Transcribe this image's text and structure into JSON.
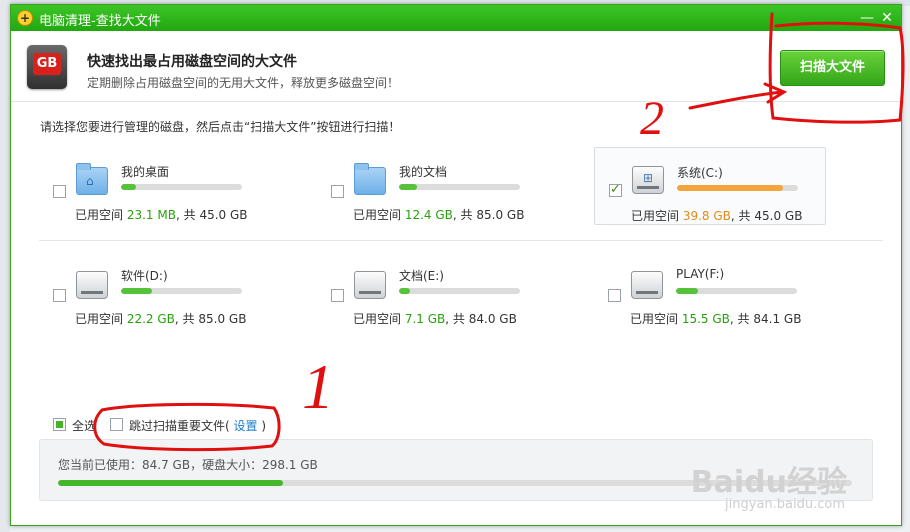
{
  "window": {
    "title": "电脑清理-查找大文件",
    "icon": "plus-icon",
    "controls": {
      "minimize": "—",
      "close": "✕"
    }
  },
  "header": {
    "icon_label": "GB",
    "title": "快速找出最占用磁盘空间的大文件",
    "subtitle": "定期删除占用磁盘空间的无用大文件，释放更多磁盘空间！",
    "scan_button": "扫描大文件"
  },
  "instruction": "请选择您要进行管理的磁盘，然后点击“扫描大文件”按钮进行扫描！",
  "usage_prefix": "已用空间",
  "usage_sep": ", 共",
  "drives": [
    {
      "name": "我的桌面",
      "icon": "desktop-folder-icon",
      "checked": false,
      "used": "23.1 MB",
      "total": "45.0 GB",
      "fill": 0.12,
      "color": "#56c13a"
    },
    {
      "name": "我的文档",
      "icon": "documents-folder-icon",
      "checked": false,
      "used": "12.4 GB",
      "total": "85.0 GB",
      "fill": 0.15,
      "color": "#56c13a"
    },
    {
      "name": "系统(C:)",
      "icon": "system-drive-icon",
      "checked": true,
      "used": "39.8 GB",
      "total": "45.0 GB",
      "fill": 0.88,
      "color": "#f3a43a"
    },
    {
      "name": "软件(D:)",
      "icon": "hard-drive-icon",
      "checked": false,
      "used": "22.2 GB",
      "total": "85.0 GB",
      "fill": 0.26,
      "color": "#56c13a"
    },
    {
      "name": "文档(E:)",
      "icon": "hard-drive-icon",
      "checked": false,
      "used": "7.1 GB",
      "total": "84.0 GB",
      "fill": 0.09,
      "color": "#56c13a"
    },
    {
      "name": "PLAY(F:)",
      "icon": "hard-drive-icon",
      "checked": false,
      "used": "15.5 GB",
      "total": "84.1 GB",
      "fill": 0.18,
      "color": "#56c13a"
    }
  ],
  "options": {
    "select_all": "全选",
    "skip_important": "跳过扫描重要文件(",
    "settings_link": "设置",
    "paren_close": ")"
  },
  "status": {
    "text": "您当前已使用：84.7 GB，硬盘大小：298.1 GB",
    "fill": 0.284
  },
  "annotations": {
    "one": "1",
    "two": "2"
  },
  "watermark": {
    "logo": "Baidu经验",
    "url": "jingyan.baidu.com"
  }
}
